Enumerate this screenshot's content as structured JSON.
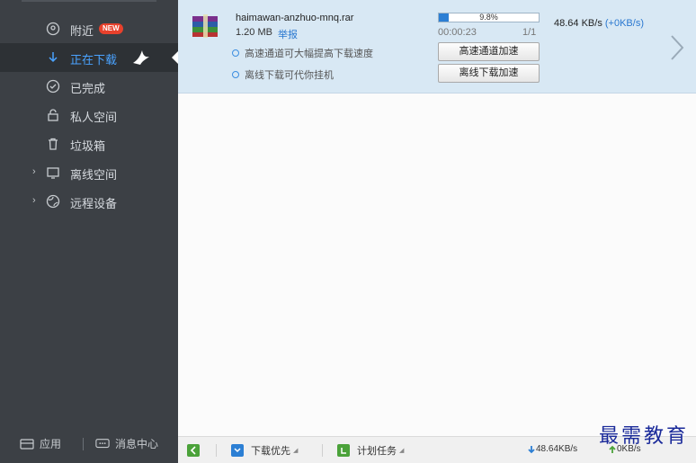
{
  "sidebar": {
    "items": [
      {
        "label": "附近",
        "badge": "NEW",
        "icon": "location-pin-icon"
      },
      {
        "label": "正在下载",
        "icon": "download-arrow-icon",
        "active": true
      },
      {
        "label": "已完成",
        "icon": "check-circle-icon"
      },
      {
        "label": "私人空间",
        "icon": "lock-icon"
      },
      {
        "label": "垃圾箱",
        "icon": "trash-icon"
      },
      {
        "label": "离线空间",
        "icon": "cloud-monitor-icon"
      },
      {
        "label": "远程设备",
        "icon": "globe-device-icon"
      }
    ],
    "bottom": {
      "apps_label": "应用",
      "messages_label": "消息中心"
    }
  },
  "task": {
    "file_name": "haimawan-anzhuo-mnq.rar",
    "file_size": "1.20 MB",
    "report_label": "举报",
    "progress_percent": 9.8,
    "progress_text": "9.8%",
    "elapsed": "00:00:23",
    "count": "1/1",
    "speed": "48.64",
    "speed_unit": "KB/s",
    "speed_delta": "(+0KB/s)",
    "hints": [
      "高速通道可大幅提高下载速度",
      "离线下载可代你挂机"
    ],
    "buttons": {
      "high_speed": "高速通道加速",
      "offline": "离线下载加速"
    }
  },
  "toolbar": {
    "priority_label": "下载优先",
    "schedule_label": "计划任务",
    "download_speed": "48.64KB/s",
    "upload_speed": "0KB/s"
  },
  "watermark": "最需教育",
  "colors": {
    "sidebar_bg": "#3c4045",
    "active_text": "#4aa3ff",
    "task_row_bg": "#d8e8f4",
    "progress": "#2c7fd4",
    "badge": "#e8412c"
  }
}
